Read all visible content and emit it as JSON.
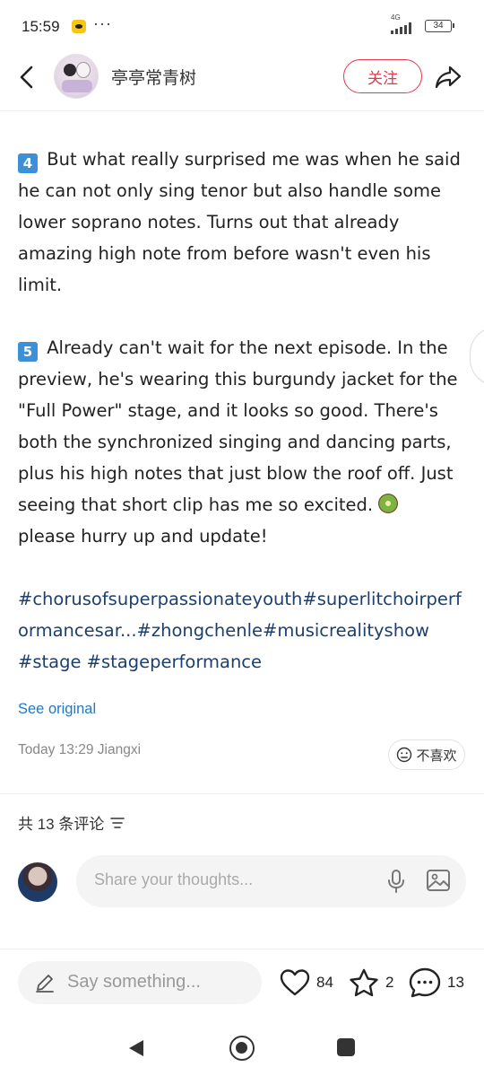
{
  "status_bar": {
    "time": "15:59",
    "menu_dots": "···",
    "network": "4G",
    "battery": "34"
  },
  "header": {
    "username": "亭亭常青树",
    "follow_label": "关注"
  },
  "post": {
    "para4": {
      "number": "4",
      "text": "But what really surprised me was when he said he can not only sing tenor but also handle some lower soprano notes. Turns out that already amazing high note from before wasn't even his limit."
    },
    "para5": {
      "number": "5",
      "text": "Already can't wait for the next episode. In the preview, he's wearing this burgundy jacket for the \"Full Power\" stage, and it looks so good. There's both the synchronized singing and dancing parts, plus his high notes that just blow the roof off. Just seeing that short clip has me so excited.",
      "text_after": "please hurry up and update!"
    },
    "hashtags_line1": "#chorusofsuperpassionateyouth#superlitchoirperformancesar...#zhongchenle#musicrealityshow",
    "hashtags_line2": "#stage #stageperformance"
  },
  "see_original": "See original",
  "meta": {
    "time_location": "Today 13:29 Jiangxi",
    "dislike_label": "不喜欢"
  },
  "comments": {
    "count_label": "共 13 条评论",
    "input_placeholder": "Share your thoughts..."
  },
  "bottom_bar": {
    "say_placeholder": "Say something...",
    "likes": "84",
    "favorites": "2",
    "comments": "13"
  },
  "colors": {
    "accent_red": "#e8364b",
    "link_blue": "#1f78c8",
    "hashtag_blue": "#1d3f6e",
    "number_box": "#3d8fd6"
  }
}
